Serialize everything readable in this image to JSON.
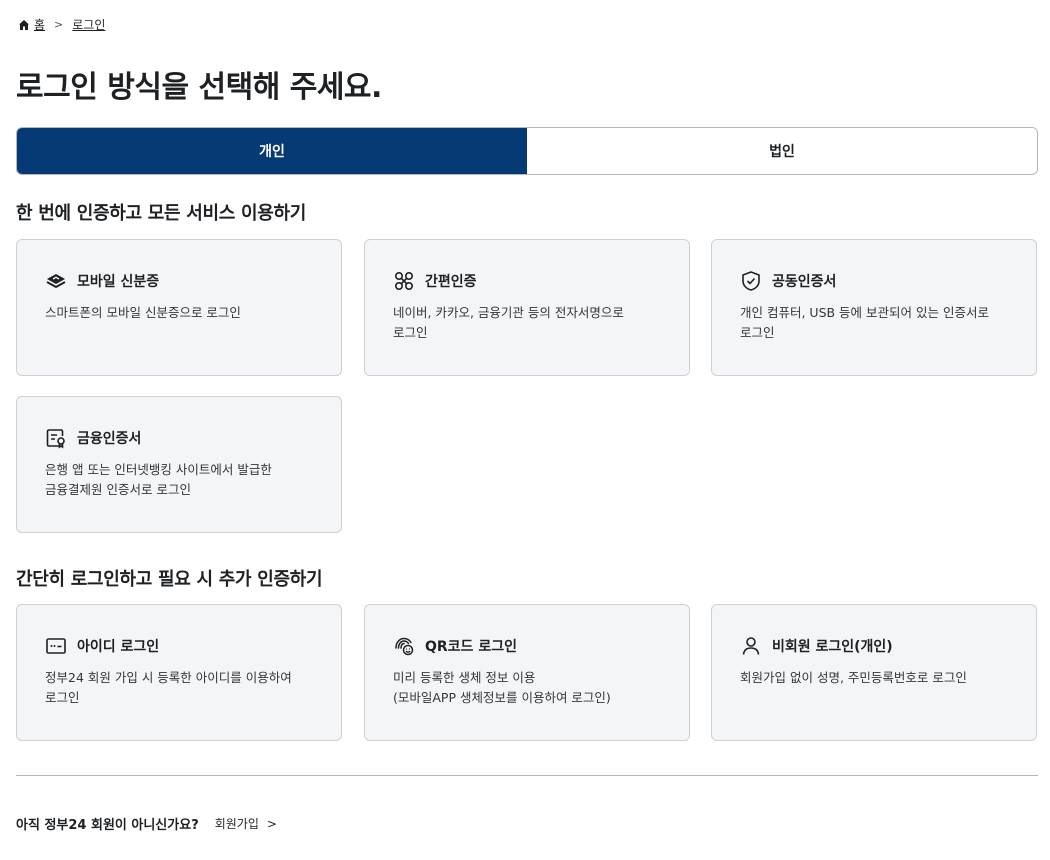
{
  "breadcrumb": {
    "home": "홈",
    "current": "로그인"
  },
  "page_title": "로그인 방식을 선택해 주세요.",
  "tabs": [
    {
      "label": "개인",
      "active": true
    },
    {
      "label": "법인",
      "active": false
    }
  ],
  "section1": {
    "heading": "한 번에 인증하고 모든 서비스 이용하기",
    "cards": [
      {
        "icon": "mobile-id-icon",
        "title": "모바일 신분증",
        "desc": "스마트폰의 모바일 신분증으로 로그인"
      },
      {
        "icon": "simple-auth-icon",
        "title": "간편인증",
        "desc": "네이버, 카카오, 금융기관 등의 전자서명으로\n로그인"
      },
      {
        "icon": "shield-check-icon",
        "title": "공동인증서",
        "desc": "개인 컴퓨터, USB 등에 보관되어 있는 인증서로\n로그인"
      },
      {
        "icon": "certificate-icon",
        "title": "금융인증서",
        "desc": "은행 앱 또는 인터넷뱅킹 사이트에서 발급한\n금융결제원 인증서로 로그인"
      }
    ]
  },
  "section2": {
    "heading": "간단히 로그인하고 필요 시 추가 인증하기",
    "cards": [
      {
        "icon": "id-password-icon",
        "title": "아이디 로그인",
        "desc": "정부24 회원 가입 시 등록한 아이디를 이용하여\n로그인"
      },
      {
        "icon": "fingerprint-face-icon",
        "title": "QR코드 로그인",
        "desc": "미리 등록한 생체 정보 이용\n(모바일APP 생체정보를 이용하여 로그인)"
      },
      {
        "icon": "person-icon",
        "title": "비회원 로그인(개인)",
        "desc": "회원가입 없이 성명, 주민등록번호로 로그인"
      }
    ]
  },
  "footer": {
    "question": "아직 정부24 회원이 아니신가요?",
    "signup_link": "회원가입"
  },
  "colors": {
    "active_tab": "#063a74",
    "card_bg": "#f4f5f6",
    "border": "#cdd1d5"
  }
}
